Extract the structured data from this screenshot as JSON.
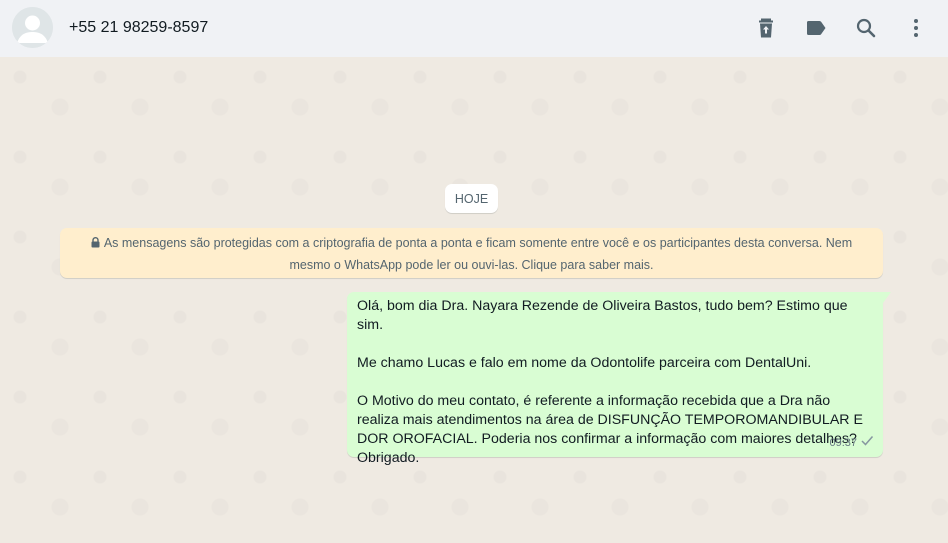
{
  "header": {
    "contact_name": "+55 21 98259-8597",
    "icons": [
      "delete-icon",
      "label-icon",
      "search-icon",
      "menu-icon"
    ]
  },
  "chat": {
    "date_chip": "HOJE",
    "encryption_notice": "As mensagens são protegidas com a criptografia de ponta a ponta e ficam somente entre você e os participantes desta conversa. Nem mesmo o WhatsApp pode ler ou ouvi-las. Clique para saber mais.",
    "message": {
      "paragraphs": [
        "Olá, bom dia Dra. Nayara Rezende de Oliveira Bastos, tudo bem? Estimo que sim.",
        "Me chamo Lucas e falo em nome da Odontolife parceira com DentalUni.",
        "O Motivo do meu contato, é referente a informação recebida que a Dra não realiza mais atendimentos na área de DISFUNÇÃO TEMPOROMANDIBULAR E DOR OROFACIAL. Poderia nos confirmar a informação com maiores detalhes? Obrigado."
      ],
      "time": "09:37",
      "status": "sent-check-icon"
    }
  },
  "colors": {
    "header_bg": "#f0f2f5",
    "chat_bg": "#efeae2",
    "outgoing_bubble": "#d9fdd3",
    "notice_bg": "#ffeecd",
    "icon_color": "#54656f"
  }
}
